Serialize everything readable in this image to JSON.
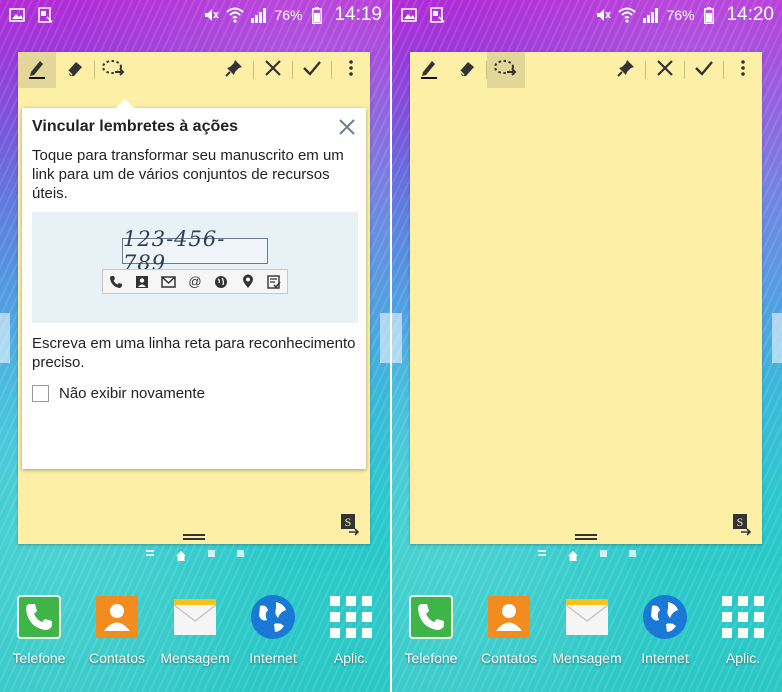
{
  "left_screen": {
    "status": {
      "battery": "76%",
      "time": "14:19"
    },
    "popup": {
      "title": "Vincular lembretes à ações",
      "description": "Toque para transformar seu manuscrito em um link para um de vários conjuntos de recursos úteis.",
      "example_number": "123-456-789",
      "hint": "Escreva em uma linha reta para reconhecimento preciso.",
      "checkbox_label": "Não exibir novamente",
      "checkbox_checked": false
    }
  },
  "right_screen": {
    "status": {
      "battery": "76%",
      "time": "14:20"
    }
  },
  "toolbar": {
    "icons": [
      "pen-icon",
      "eraser-icon",
      "lasso-link-icon",
      "pin-icon",
      "close-icon",
      "check-icon",
      "more-icon"
    ],
    "left_active": "pen-icon",
    "right_active": "lasso-link-icon"
  },
  "dock": {
    "apps": [
      {
        "label": "Telefone",
        "icon": "phone-icon"
      },
      {
        "label": "Contatos",
        "icon": "contacts-icon"
      },
      {
        "label": "Mensagem",
        "icon": "message-icon"
      },
      {
        "label": "Internet",
        "icon": "globe-icon"
      },
      {
        "label": "Aplic.",
        "icon": "apps-grid-icon"
      }
    ]
  },
  "colors": {
    "memo_background": "#fdf0a6",
    "active_tool": "#e2d699",
    "popup_example_bg": "#e8f1f6"
  }
}
